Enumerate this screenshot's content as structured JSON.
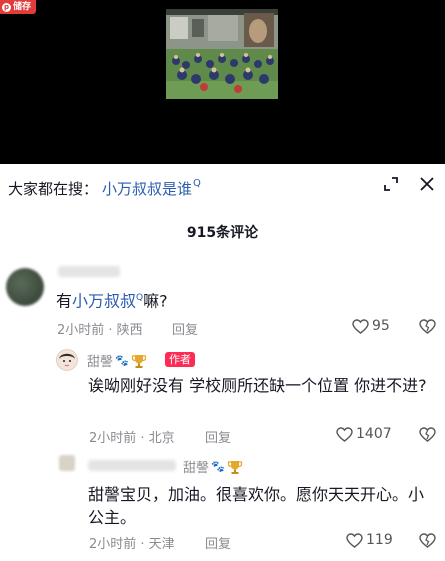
{
  "video": {
    "save_badge": "储存"
  },
  "search": {
    "prefix": "大家都在搜：",
    "term": "小万叔叔是谁",
    "q_icon": "Q"
  },
  "comments_title": "915条评论",
  "comments": [
    {
      "text_prefix": "有",
      "mention": "小万叔叔",
      "mention_q": "Q",
      "text_suffix": "嘛?",
      "time_loc": "2小时前 · 陕西",
      "reply": "回复",
      "likes": "95"
    },
    {
      "user": "甜謦",
      "author_tag": "作者",
      "text": "诶呦刚好没有 学校厕所还缺一个位置 你进不进?",
      "time_loc": "2小时前 · 北京",
      "reply": "回复",
      "likes": "1407"
    },
    {
      "reply_to": "甜謦",
      "text": "甜謦宝贝，加油。很喜欢你。愿你天天开心。小公主。",
      "time_loc": "2小时前 · 天津",
      "reply": "回复",
      "likes": "119"
    }
  ],
  "colors": {
    "accent_link": "#2a5db0",
    "author_tag": "#fe2c55",
    "meta_gray": "#8a8b91"
  }
}
